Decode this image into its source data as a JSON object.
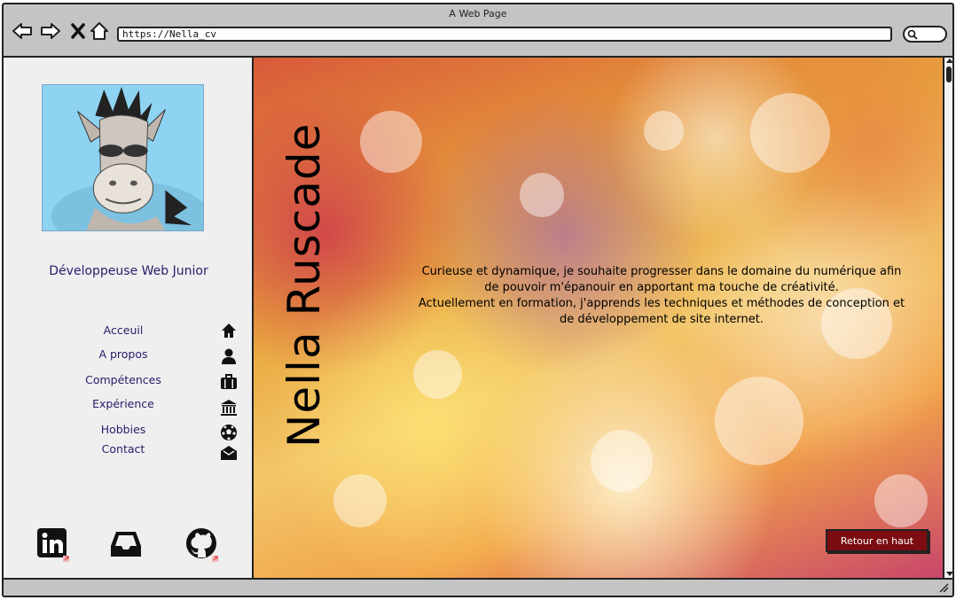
{
  "window": {
    "title": "A Web Page",
    "url": "https://Nella_cv"
  },
  "toolbar": {
    "icons": [
      "back-arrow-icon",
      "forward-arrow-icon",
      "close-x-icon",
      "home-icon",
      "search-icon"
    ]
  },
  "sidebar": {
    "role": "Développeuse Web Junior",
    "menu": [
      {
        "label": "Acceuil",
        "icon": "home-icon"
      },
      {
        "label": "A propos",
        "icon": "user-icon"
      },
      {
        "label": "Compétences",
        "icon": "briefcase-icon"
      },
      {
        "label": "Expérience",
        "icon": "bank-icon"
      },
      {
        "label": "Hobbies",
        "icon": "soccer-ball-icon"
      },
      {
        "label": "Contact",
        "icon": "envelope-open-icon"
      }
    ],
    "social": [
      "linkedin-icon",
      "inbox-icon",
      "github-icon"
    ]
  },
  "main": {
    "name": "Nella Ruscade",
    "intro_lines": [
      "Curieuse et dynamique, je souhaite progresser dans le domaine du numérique afin",
      "de pouvoir m'épanouir en apportant ma touche de créativité.",
      "Actuellement en formation, j'apprends les techniques et méthodes de conception et",
      "de développement de site internet."
    ],
    "back_to_top": "Retour en haut"
  },
  "colors": {
    "accent_text": "#2b1a6b",
    "button_bg": "#7a0c12",
    "chrome": "#c4c4c4"
  }
}
